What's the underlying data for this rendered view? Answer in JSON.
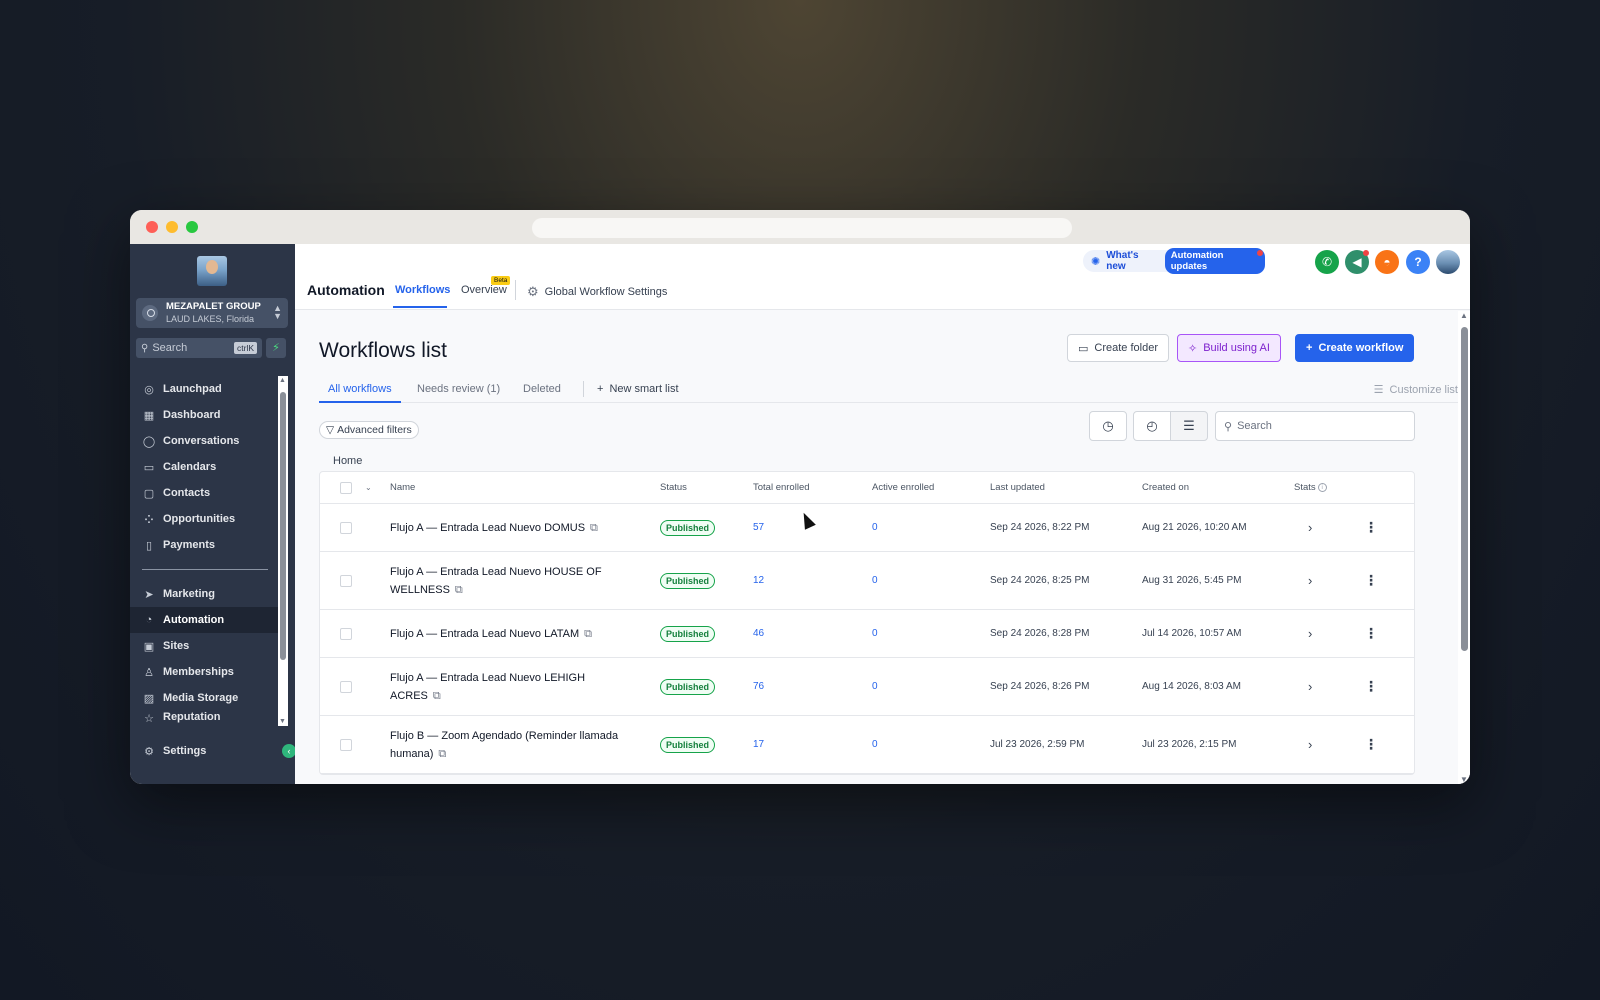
{
  "sidebar": {
    "account": {
      "name": "MEZAPALET GROUP",
      "location": "LAUD LAKES, Florida"
    },
    "search": {
      "placeholder": "Search",
      "shortcut": "ctrlK"
    },
    "nav_primary": [
      "Launchpad",
      "Dashboard",
      "Conversations",
      "Calendars",
      "Contacts",
      "Opportunities",
      "Payments"
    ],
    "nav_secondary": [
      "Marketing",
      "Automation",
      "Sites",
      "Memberships",
      "Media Storage",
      "Reputation"
    ],
    "active_item": "Automation",
    "settings_label": "Settings"
  },
  "header": {
    "app_title": "Automation",
    "tabs": {
      "workflows": "Workflows",
      "overview": "Overview",
      "beta": "Beta",
      "global_settings": "Global Workflow Settings"
    },
    "whats_new": "What's new",
    "automation_updates": "Automation updates",
    "help": "?"
  },
  "page": {
    "title": "Workflows list",
    "buttons": {
      "create_folder": "Create folder",
      "build_ai": "Build using AI",
      "create_workflow": "Create workflow"
    },
    "subtabs": {
      "all": "All workflows",
      "review": "Needs review (1)",
      "deleted": "Deleted",
      "new_smart_list": "New smart list"
    },
    "customize_list": "Customize list",
    "advanced_filters": "Advanced filters",
    "search_placeholder": "Search",
    "breadcrumb": "Home"
  },
  "table": {
    "headers": {
      "name": "Name",
      "status": "Status",
      "total": "Total enrolled",
      "active": "Active enrolled",
      "updated": "Last updated",
      "created": "Created on",
      "stats": "Stats"
    },
    "rows": [
      {
        "name": "Flujo A — Entrada Lead Nuevo DOMUS",
        "status": "Published",
        "total": "57",
        "active": "0",
        "updated": "Sep 24 2026, 8:22 PM",
        "created": "Aug 21 2026, 10:20 AM"
      },
      {
        "name": "Flujo A — Entrada Lead Nuevo HOUSE OF WELLNESS",
        "status": "Published",
        "total": "12",
        "active": "0",
        "updated": "Sep 24 2026, 8:25 PM",
        "created": "Aug 31 2026, 5:45 PM"
      },
      {
        "name": "Flujo A — Entrada Lead Nuevo LATAM",
        "status": "Published",
        "total": "46",
        "active": "0",
        "updated": "Sep 24 2026, 8:28 PM",
        "created": "Jul 14 2026, 10:57 AM"
      },
      {
        "name": "Flujo A — Entrada Lead Nuevo LEHIGH ACRES",
        "status": "Published",
        "total": "76",
        "active": "0",
        "updated": "Sep 24 2026, 8:26 PM",
        "created": "Aug 14 2026, 8:03 AM"
      },
      {
        "name": "Flujo B — Zoom Agendado (Reminder llamada humana)",
        "status": "Published",
        "total": "17",
        "active": "0",
        "updated": "Jul 23 2026, 2:59 PM",
        "created": "Jul 23 2026, 2:15 PM"
      }
    ]
  },
  "colors": {
    "accent": "#2563eb",
    "sidebar_bg": "#2c3547",
    "published_green": "#16a34a"
  }
}
